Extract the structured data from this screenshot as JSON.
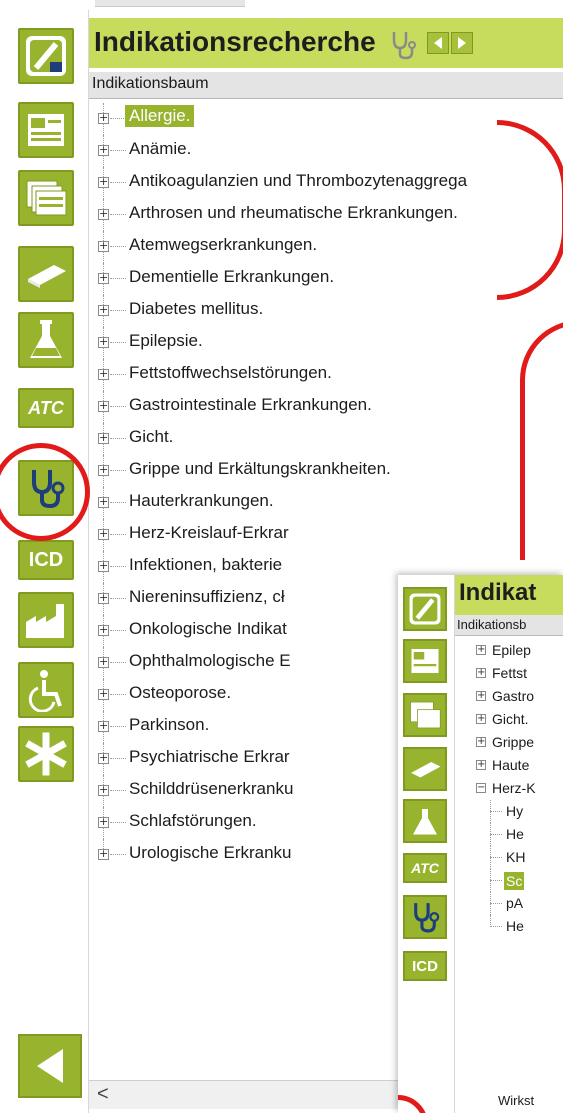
{
  "app": {
    "title": "Indikationsrecherche",
    "subheader": "Indikationsbaum"
  },
  "tree": {
    "items": [
      {
        "label": "Allergie.",
        "selected": true
      },
      {
        "label": "Anämie."
      },
      {
        "label": "Antikoagulanzien und Thrombozytenaggrega"
      },
      {
        "label": "Arthrosen und rheumatische Erkrankungen."
      },
      {
        "label": "Atemwegserkrankungen."
      },
      {
        "label": "Dementielle Erkrankungen."
      },
      {
        "label": "Diabetes mellitus."
      },
      {
        "label": "Epilepsie."
      },
      {
        "label": "Fettstoffwechselstörungen."
      },
      {
        "label": "Gastrointestinale Erkrankungen."
      },
      {
        "label": "Gicht."
      },
      {
        "label": "Grippe und Erkältungskrankheiten."
      },
      {
        "label": "Hauterkrankungen."
      },
      {
        "label": "Herz-Kreislauf-Erkrar"
      },
      {
        "label": "Infektionen, bakterie"
      },
      {
        "label": "Niereninsuffizienz, cł"
      },
      {
        "label": "Onkologische Indikat"
      },
      {
        "label": "Ophthalmologische E"
      },
      {
        "label": "Osteoporose."
      },
      {
        "label": "Parkinson."
      },
      {
        "label": "Psychiatrische Erkrar"
      },
      {
        "label": "Schilddrüsenerkranku"
      },
      {
        "label": "Schlafstörungen."
      },
      {
        "label": "Urologische Erkranku"
      }
    ]
  },
  "sidebar": {
    "icons": [
      "logo-icon",
      "document-icon",
      "pages-icon",
      "tablet-icon",
      "flask-icon",
      "atc-icon",
      "stethoscope-icon",
      "icd-icon",
      "factory-icon",
      "wheelchair-icon",
      "asterisk-icon"
    ],
    "atc_label": "ATC",
    "icd_label": "ICD"
  },
  "scroll": {
    "left_arrow": "<"
  },
  "overlay": {
    "title": "Indikat",
    "subheader": "Indikationsb",
    "atc_label": "ATC",
    "icd_label": "ICD",
    "items": [
      {
        "label": "Epilep",
        "type": "node"
      },
      {
        "label": "Fettst",
        "type": "node"
      },
      {
        "label": "Gastro",
        "type": "node"
      },
      {
        "label": "Gicht.",
        "type": "node"
      },
      {
        "label": "Grippe",
        "type": "node"
      },
      {
        "label": "Haute",
        "type": "node"
      },
      {
        "label": "Herz-K",
        "type": "expanded"
      },
      {
        "label": "Hy",
        "type": "child"
      },
      {
        "label": "He",
        "type": "child"
      },
      {
        "label": "KH",
        "type": "child"
      },
      {
        "label": "Sc",
        "type": "child",
        "selected": true
      },
      {
        "label": "pA",
        "type": "child"
      },
      {
        "label": "He",
        "type": "child"
      }
    ],
    "footer": "Wirkst"
  },
  "colors": {
    "accent": "#98b42f",
    "title_bg": "#c7dc5c",
    "annotation_red": "#e11a1a"
  }
}
